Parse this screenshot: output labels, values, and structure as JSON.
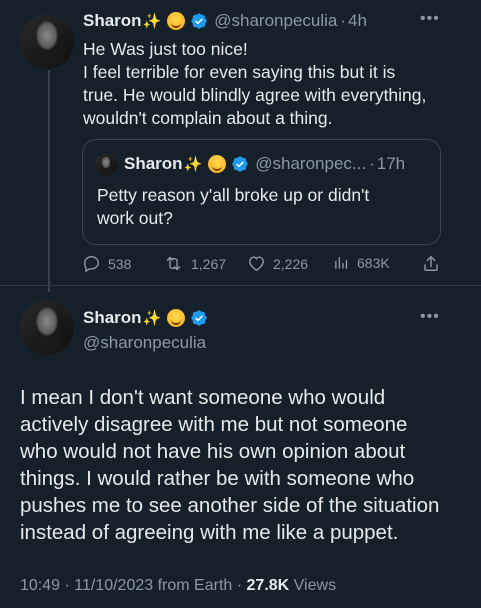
{
  "reply_tweet": {
    "author_name": "Sharon",
    "handle": "@sharonpeculia",
    "time": "4h",
    "text_lines": [
      "He Was just too nice!",
      "I feel terrible for even saying this but it is",
      "true. He would blindly agree with everything,",
      "wouldn't complain about a thing."
    ],
    "quoted": {
      "author_name": "Sharon",
      "handle": "@sharonpec...",
      "time": "17h",
      "text_lines": [
        "Petty reason y'all broke up or didn't",
        "work out?"
      ]
    },
    "actions": {
      "replies": "538",
      "retweets": "1,267",
      "likes": "2,226",
      "views": "683K"
    }
  },
  "main_tweet": {
    "author_name": "Sharon",
    "handle": "@sharonpeculia",
    "text_lines": [
      "I mean I don't want someone who would",
      "actively disagree with me but not someone",
      "who would not have his own opinion about",
      "things. I would rather be with someone who",
      "pushes me to see another side of the situation",
      "instead of agreeing with me like a puppet."
    ],
    "timestamp": "10:49 · 11/10/2023 from Earth ·",
    "views_count": "27.8K",
    "views_label": "Views"
  },
  "colors": {
    "background": "#15202b",
    "text": "#e7e9ea",
    "secondary_text": "#8b98a5",
    "verified_blue": "#1d9bf0",
    "border": "#38444d"
  },
  "icons": [
    "more-icon",
    "verified-badge-icon",
    "sparkles-emoji",
    "smiling-face-emoji",
    "reply-icon",
    "retweet-icon",
    "like-icon",
    "views-icon",
    "share-icon"
  ]
}
